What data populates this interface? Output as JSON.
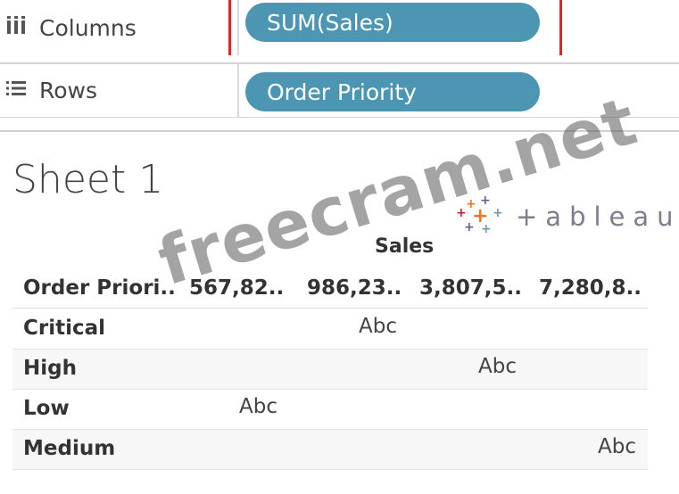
{
  "shelves": {
    "columns": {
      "label": "Columns",
      "icon": "columns-icon",
      "pill": "SUM(Sales)"
    },
    "rows": {
      "label": "Rows",
      "icon": "rows-icon",
      "pill": "Order Priority"
    }
  },
  "sheet": {
    "title": "Sheet 1"
  },
  "logo": {
    "text": "+ableau"
  },
  "watermark": "freecram.net",
  "table": {
    "column_group": "Sales",
    "row_header": "Order Priori..",
    "column_headers": [
      "567,82..",
      "986,23..",
      "3,807,5..",
      "7,280,8.."
    ],
    "rows": [
      {
        "label": "Critical",
        "mark": "Abc",
        "column_index": 1
      },
      {
        "label": "High",
        "mark": "Abc",
        "column_index": 2
      },
      {
        "label": "Low",
        "mark": "Abc",
        "column_index": 0
      },
      {
        "label": "Medium",
        "mark": "Abc",
        "column_index": 3
      }
    ]
  },
  "colors": {
    "pill": "#4c96b3",
    "highlight": "#e02424",
    "logo_text": "#7c7e8d"
  }
}
